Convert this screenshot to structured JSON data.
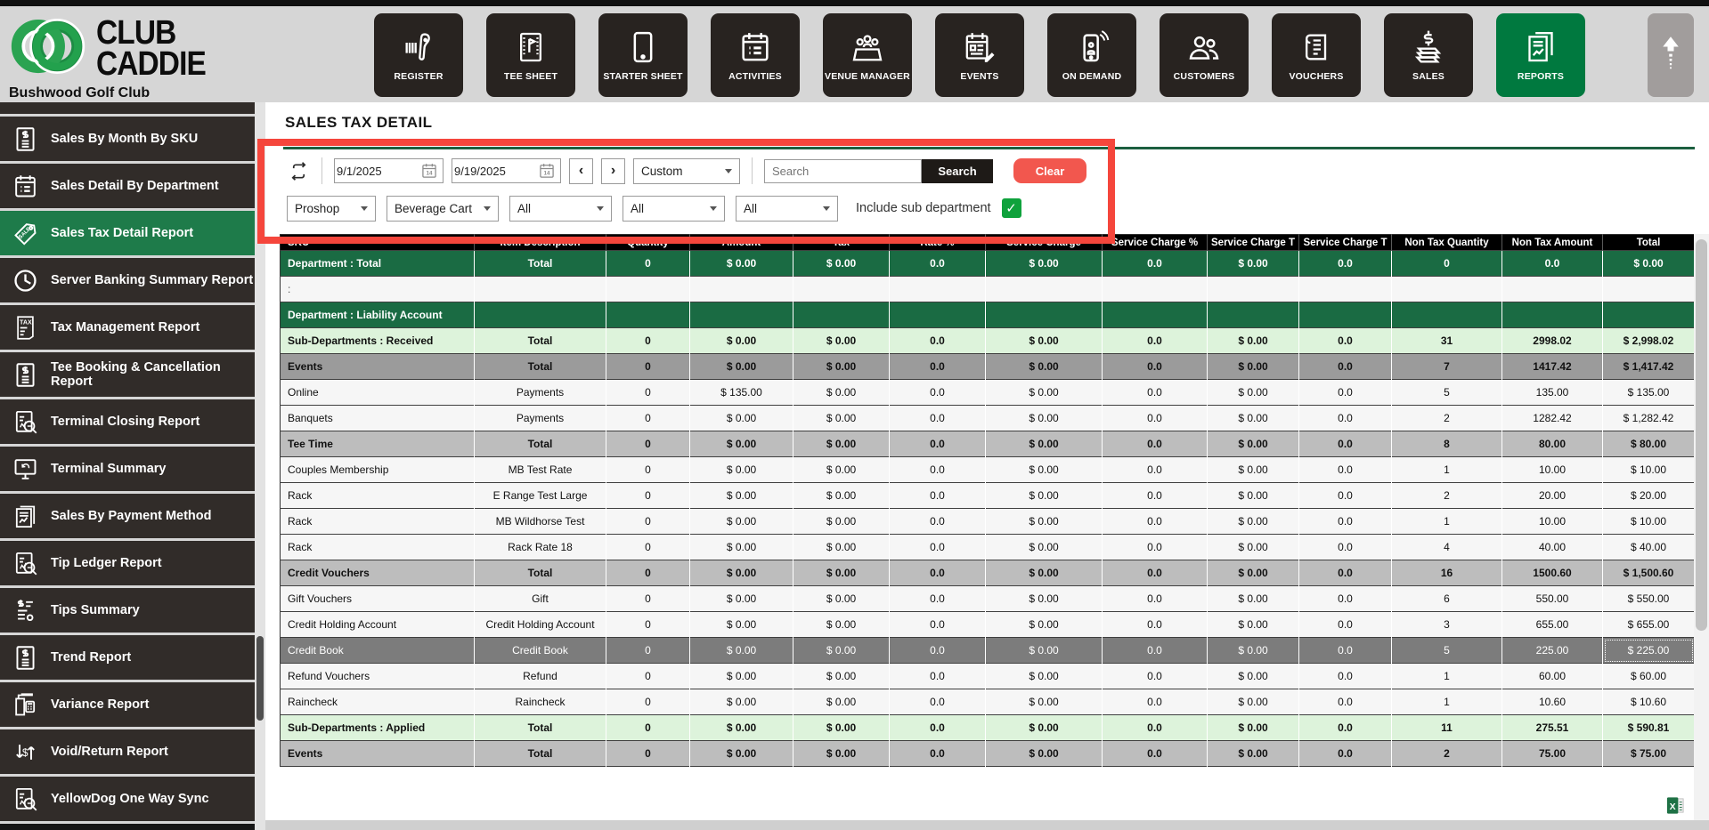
{
  "brand": {
    "name_line1": "CLUB",
    "name_line2": "CADDIE",
    "club_name": "Bushwood Golf Club"
  },
  "nav": {
    "active": "REPORTS",
    "items": [
      {
        "label": "REGISTER",
        "icon": "register"
      },
      {
        "label": "TEE SHEET",
        "icon": "tee-sheet"
      },
      {
        "label": "STARTER SHEET",
        "icon": "starter-sheet"
      },
      {
        "label": "ACTIVITIES",
        "icon": "activities"
      },
      {
        "label": "VENUE MANAGER",
        "icon": "venue-manager"
      },
      {
        "label": "EVENTS",
        "icon": "events"
      },
      {
        "label": "ON DEMAND",
        "icon": "on-demand"
      },
      {
        "label": "CUSTOMERS",
        "icon": "customers"
      },
      {
        "label": "VOUCHERS",
        "icon": "vouchers"
      },
      {
        "label": "SALES",
        "icon": "sales"
      },
      {
        "label": "REPORTS",
        "icon": "reports"
      }
    ]
  },
  "sidebar": {
    "items": [
      {
        "label": "Sales By Month By SKU",
        "icon": "doc-dollar",
        "active": false
      },
      {
        "label": "Sales Detail By Department",
        "icon": "calendar-list",
        "active": false
      },
      {
        "label": "Sales Tax Detail Report",
        "icon": "sale-tag",
        "active": true
      },
      {
        "label": "Server Banking Summary Report",
        "icon": "clock",
        "active": false
      },
      {
        "label": "Tax Management Report",
        "icon": "tax-doc",
        "active": false
      },
      {
        "label": "Tee Booking & Cancellation Report",
        "icon": "doc-dollar",
        "active": false
      },
      {
        "label": "Terminal Closing Report",
        "icon": "report-magnify",
        "active": false
      },
      {
        "label": "Terminal Summary",
        "icon": "monitor-refresh",
        "active": false
      },
      {
        "label": "Sales By Payment Method",
        "icon": "pages-chart",
        "active": false
      },
      {
        "label": "Tip Ledger Report",
        "icon": "report-magnify",
        "active": false
      },
      {
        "label": "Tips Summary",
        "icon": "tips-list",
        "active": false
      },
      {
        "label": "Trend Report",
        "icon": "doc-dollar",
        "active": false
      },
      {
        "label": "Variance Report",
        "icon": "variance-docs",
        "active": false
      },
      {
        "label": "Void/Return Report",
        "icon": "void-return",
        "active": false
      },
      {
        "label": "YellowDog One Way Sync",
        "icon": "report-magnify",
        "active": false
      }
    ]
  },
  "report": {
    "title": "SALES TAX DETAIL",
    "filters": {
      "date_from": "9/1/2025",
      "date_to": "9/19/2025",
      "prev_label": "‹",
      "next_label": "›",
      "range_preset": "Custom",
      "search_placeholder": "Search",
      "search_label": "Search",
      "clear_label": "Clear",
      "selects": [
        "Proshop",
        "Beverage Cart",
        "All",
        "All",
        "All"
      ],
      "include_sub_department_label": "Include sub department",
      "include_sub_department_checked": true
    },
    "table": {
      "columns": [
        "SKU",
        "Item Description",
        "Quantity",
        "Amount",
        "Tax",
        "Rate %",
        "Service Charge",
        "Service Charge %",
        "Service Charge T",
        "Service Charge T",
        "Non Tax Quantity",
        "Non Tax Amount",
        "Total"
      ],
      "rows": [
        {
          "style": "dept-total",
          "cells": [
            "Department : Total",
            "Total",
            "0",
            "$ 0.00",
            "$ 0.00",
            "0.0",
            "$ 0.00",
            "0.0",
            "$ 0.00",
            "0.0",
            "0",
            "0.0",
            "$ 0.00"
          ]
        },
        {
          "style": "spacer",
          "cells": [
            ":",
            "",
            "",
            "",
            "",
            "",
            "",
            "",
            "",
            "",
            "",
            "",
            ""
          ]
        },
        {
          "style": "dept-header",
          "cells": [
            "Department : Liability Account",
            "",
            "",
            "",
            "",
            "",
            "",
            "",
            "",
            "",
            "",
            "",
            ""
          ]
        },
        {
          "style": "subdept",
          "cells": [
            "Sub-Departments : Received",
            "Total",
            "0",
            "$ 0.00",
            "$ 0.00",
            "0.0",
            "$ 0.00",
            "0.0",
            "$ 0.00",
            "0.0",
            "31",
            "2998.02",
            "$ 2,998.02"
          ]
        },
        {
          "style": "category-dark",
          "cells": [
            "Events",
            "Total",
            "0",
            "$ 0.00",
            "$ 0.00",
            "0.0",
            "$ 0.00",
            "0.0",
            "$ 0.00",
            "0.0",
            "7",
            "1417.42",
            "$ 1,417.42"
          ]
        },
        {
          "style": "item",
          "cells": [
            "Online",
            "Payments",
            "0",
            "$ 135.00",
            "$ 0.00",
            "0.0",
            "$ 0.00",
            "0.0",
            "$ 0.00",
            "0.0",
            "5",
            "135.00",
            "$ 135.00"
          ]
        },
        {
          "style": "item",
          "cells": [
            "Banquets",
            "Payments",
            "0",
            "$ 0.00",
            "$ 0.00",
            "0.0",
            "$ 0.00",
            "0.0",
            "$ 0.00",
            "0.0",
            "2",
            "1282.42",
            "$ 1,282.42"
          ]
        },
        {
          "style": "category",
          "cells": [
            "Tee Time",
            "Total",
            "0",
            "$ 0.00",
            "$ 0.00",
            "0.0",
            "$ 0.00",
            "0.0",
            "$ 0.00",
            "0.0",
            "8",
            "80.00",
            "$ 80.00"
          ]
        },
        {
          "style": "item",
          "cells": [
            "Couples Membership",
            "MB Test Rate",
            "0",
            "$ 0.00",
            "$ 0.00",
            "0.0",
            "$ 0.00",
            "0.0",
            "$ 0.00",
            "0.0",
            "1",
            "10.00",
            "$ 10.00"
          ]
        },
        {
          "style": "item",
          "cells": [
            "Rack",
            "E Range Test Large",
            "0",
            "$ 0.00",
            "$ 0.00",
            "0.0",
            "$ 0.00",
            "0.0",
            "$ 0.00",
            "0.0",
            "2",
            "20.00",
            "$ 20.00"
          ]
        },
        {
          "style": "item",
          "cells": [
            "Rack",
            "MB Wildhorse Test",
            "0",
            "$ 0.00",
            "$ 0.00",
            "0.0",
            "$ 0.00",
            "0.0",
            "$ 0.00",
            "0.0",
            "1",
            "10.00",
            "$ 10.00"
          ]
        },
        {
          "style": "item",
          "cells": [
            "Rack",
            "Rack Rate 18",
            "0",
            "$ 0.00",
            "$ 0.00",
            "0.0",
            "$ 0.00",
            "0.0",
            "$ 0.00",
            "0.0",
            "4",
            "40.00",
            "$ 40.00"
          ]
        },
        {
          "style": "category",
          "cells": [
            "Credit Vouchers",
            "Total",
            "0",
            "$ 0.00",
            "$ 0.00",
            "0.0",
            "$ 0.00",
            "0.0",
            "$ 0.00",
            "0.0",
            "16",
            "1500.60",
            "$ 1,500.60"
          ]
        },
        {
          "style": "item",
          "cells": [
            "Gift Vouchers",
            "Gift",
            "0",
            "$ 0.00",
            "$ 0.00",
            "0.0",
            "$ 0.00",
            "0.0",
            "$ 0.00",
            "0.0",
            "6",
            "550.00",
            "$ 550.00"
          ]
        },
        {
          "style": "item",
          "cells": [
            "Credit Holding Account",
            "Credit Holding Account",
            "0",
            "$ 0.00",
            "$ 0.00",
            "0.0",
            "$ 0.00",
            "0.0",
            "$ 0.00",
            "0.0",
            "3",
            "655.00",
            "$ 655.00"
          ]
        },
        {
          "style": "selected",
          "cells": [
            "Credit Book",
            "Credit Book",
            "0",
            "$ 0.00",
            "$ 0.00",
            "0.0",
            "$ 0.00",
            "0.0",
            "$ 0.00",
            "0.0",
            "5",
            "225.00",
            "$ 225.00"
          ]
        },
        {
          "style": "item",
          "cells": [
            "Refund Vouchers",
            "Refund",
            "0",
            "$ 0.00",
            "$ 0.00",
            "0.0",
            "$ 0.00",
            "0.0",
            "$ 0.00",
            "0.0",
            "1",
            "60.00",
            "$ 60.00"
          ]
        },
        {
          "style": "item",
          "cells": [
            "Raincheck",
            "Raincheck",
            "0",
            "$ 0.00",
            "$ 0.00",
            "0.0",
            "$ 0.00",
            "0.0",
            "$ 0.00",
            "0.0",
            "1",
            "10.60",
            "$ 10.60"
          ]
        },
        {
          "style": "subdept",
          "cells": [
            "Sub-Departments : Applied",
            "Total",
            "0",
            "$ 0.00",
            "$ 0.00",
            "0.0",
            "$ 0.00",
            "0.0",
            "$ 0.00",
            "0.0",
            "11",
            "275.51",
            "$ 590.81"
          ]
        },
        {
          "style": "category",
          "cells": [
            "Events",
            "Total",
            "0",
            "$ 0.00",
            "$ 0.00",
            "0.0",
            "$ 0.00",
            "0.0",
            "$ 0.00",
            "0.0",
            "2",
            "75.00",
            "$ 75.00"
          ]
        }
      ]
    }
  },
  "colors": {
    "brand_green": "#23a14d",
    "nav_active_green": "#00793f",
    "sidebar_active_green": "#1e7b4a",
    "dept_row_green": "#1a6b43",
    "subdept_row_green": "#ddf3db",
    "clear_button_red": "#f2574e",
    "annotation_red": "#f5463c",
    "checkbox_green": "#0fa23c",
    "excel_green": "#1e7145"
  }
}
